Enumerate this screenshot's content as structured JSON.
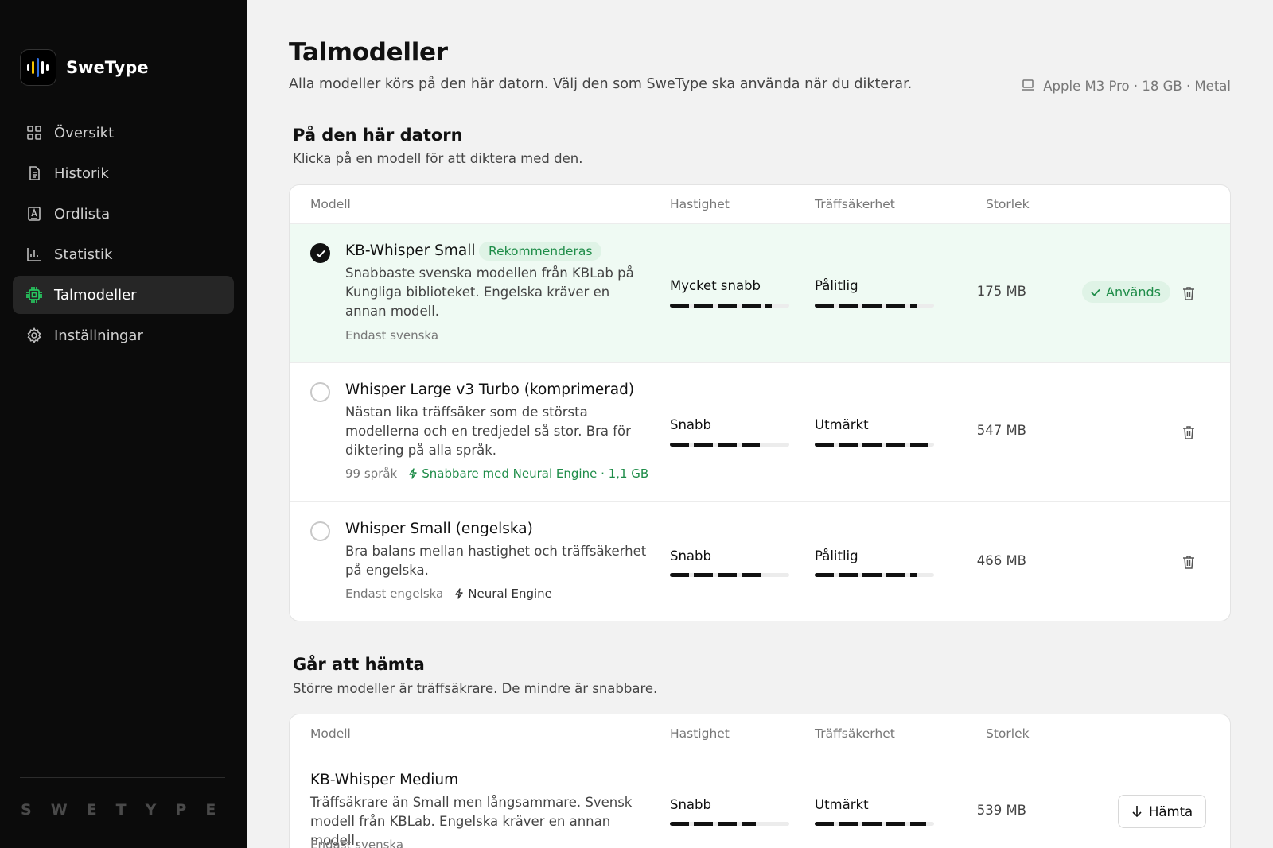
{
  "brand": {
    "name": "SweType",
    "footer_letters": [
      "S",
      "W",
      "E",
      "T",
      "Y",
      "P",
      "E"
    ]
  },
  "nav": [
    {
      "label": "Översikt",
      "icon": "grid-icon"
    },
    {
      "label": "Historik",
      "icon": "document-icon"
    },
    {
      "label": "Ordlista",
      "icon": "dictionary-icon"
    },
    {
      "label": "Statistik",
      "icon": "bar-chart-icon"
    },
    {
      "label": "Talmodeller",
      "icon": "chip-icon",
      "active": true
    },
    {
      "label": "Inställningar",
      "icon": "gear-icon"
    }
  ],
  "page": {
    "title": "Talmodeller",
    "subtitle": "Alla modeller körs på den här datorn. Välj den som SweType ska använda när du dikterar.",
    "device": "Apple M3 Pro · 18 GB · Metal"
  },
  "columns": {
    "model": "Modell",
    "speed": "Hastighet",
    "accuracy": "Träffsäkerhet",
    "size": "Storlek"
  },
  "installed": {
    "title": "På den här datorn",
    "subtitle": "Klicka på en modell för att diktera med den.",
    "models": [
      {
        "name": "KB-Whisper Small",
        "badge": "Rekommenderas",
        "desc": "Snabbaste svenska modellen från KBLab på Kungliga biblioteket. Engelska kräver en annan modell.",
        "lang": "Endast svenska",
        "speed_label": "Mycket snabb",
        "speed_level": 0.85,
        "accuracy_label": "Pålitlig",
        "accuracy_level": 0.85,
        "size": "175 MB",
        "in_use_label": "Används",
        "selected": true
      },
      {
        "name": "Whisper Large v3 Turbo (komprimerad)",
        "desc": "Nästan lika träffsäker som de största modellerna och en tredjedel så stor. Bra för diktering på alla språk.",
        "lang": "99 språk",
        "extra": "Snabbare med Neural Engine · 1,1 GB",
        "speed_label": "Snabb",
        "speed_level": 0.75,
        "accuracy_label": "Utmärkt",
        "accuracy_level": 0.95,
        "size": "547 MB"
      },
      {
        "name": "Whisper Small (engelska)",
        "desc": "Bra balans mellan hastighet och träffsäkerhet på engelska.",
        "lang": "Endast engelska",
        "extra": "Neural Engine",
        "speed_label": "Snabb",
        "speed_level": 0.8,
        "accuracy_label": "Pålitlig",
        "accuracy_level": 0.85,
        "size": "466 MB"
      }
    ]
  },
  "available": {
    "title": "Går att hämta",
    "subtitle": "Större modeller är träffsäkrare. De mindre är snabbare.",
    "models": [
      {
        "name": "KB-Whisper Medium",
        "desc": "Träffsäkrare än Small men långsammare. Svensk modell från KBLab. Engelska kräver en annan modell.",
        "lang": "Endast svenska",
        "speed_label": "Snabb",
        "speed_level": 0.72,
        "accuracy_label": "Utmärkt",
        "accuracy_level": 0.93,
        "size": "539 MB",
        "download_label": "Hämta"
      }
    ]
  },
  "colors": {
    "accent_green": "#1e8c48",
    "selected_bg": "#effaf3",
    "sidebar_bg": "#0b0b0b"
  }
}
